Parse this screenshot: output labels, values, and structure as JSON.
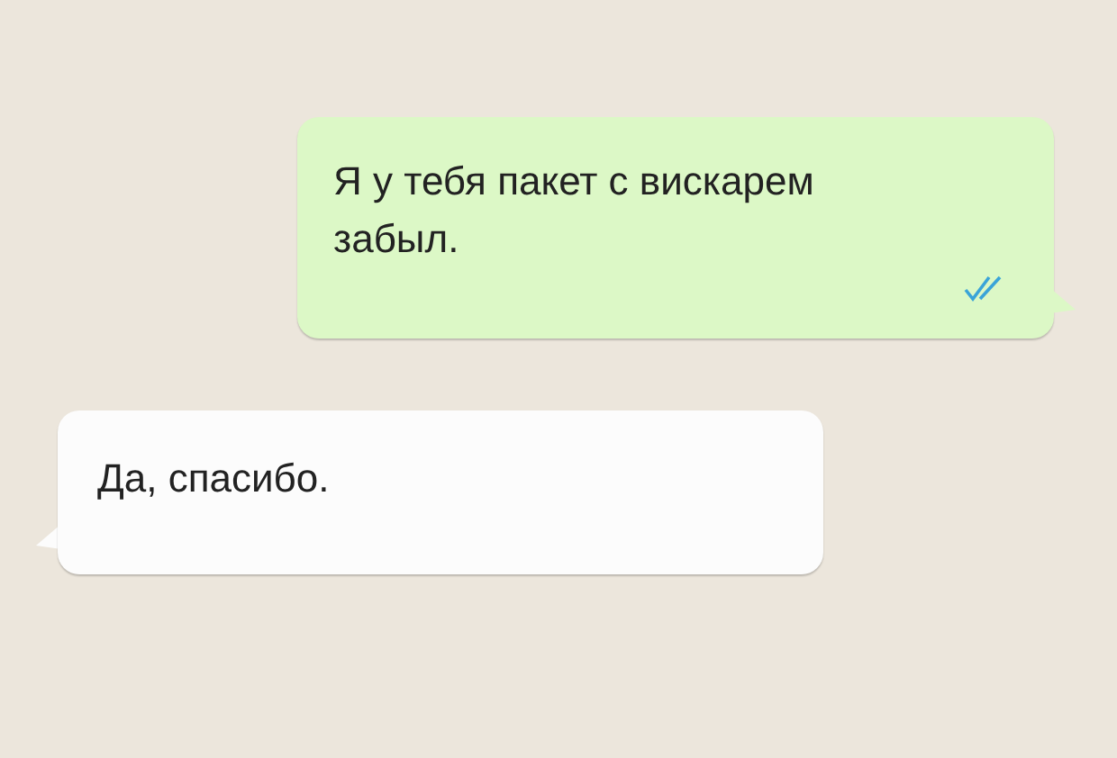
{
  "messages": [
    {
      "kind": "outgoing",
      "text": "Я у тебя пакет с вискарем забыл.",
      "read": true
    },
    {
      "kind": "incoming",
      "text": "Да, спасибо."
    }
  ]
}
